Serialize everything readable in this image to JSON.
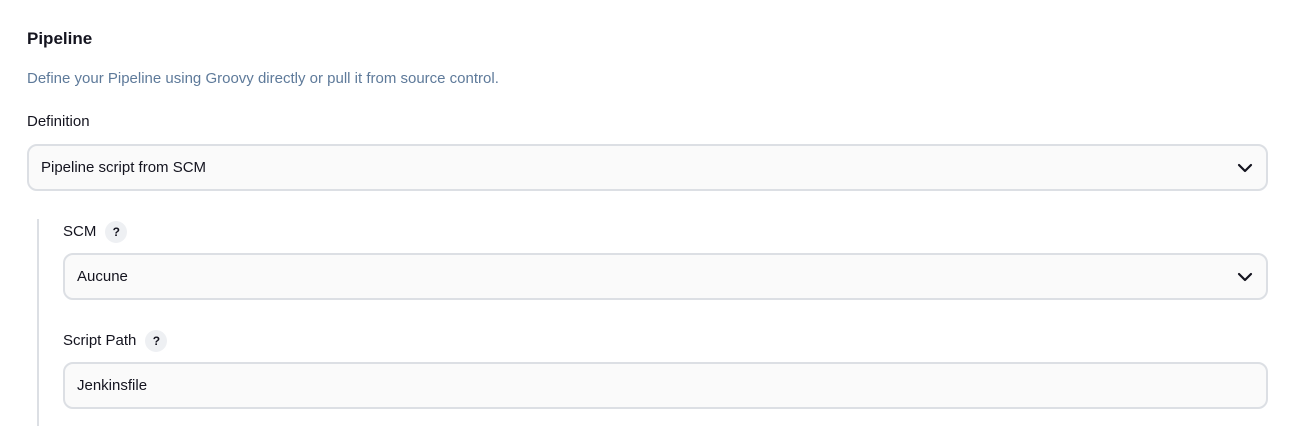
{
  "section": {
    "title": "Pipeline",
    "description": "Define your Pipeline using Groovy directly or pull it from source control."
  },
  "definition": {
    "label": "Definition",
    "selected": "Pipeline script from SCM"
  },
  "scm": {
    "label": "SCM",
    "help": "?",
    "selected": "Aucune"
  },
  "script_path": {
    "label": "Script Path",
    "help": "?",
    "value": "Jenkinsfile"
  },
  "icons": {
    "dropdown": "chevron-down-icon",
    "help": "help-icon"
  }
}
